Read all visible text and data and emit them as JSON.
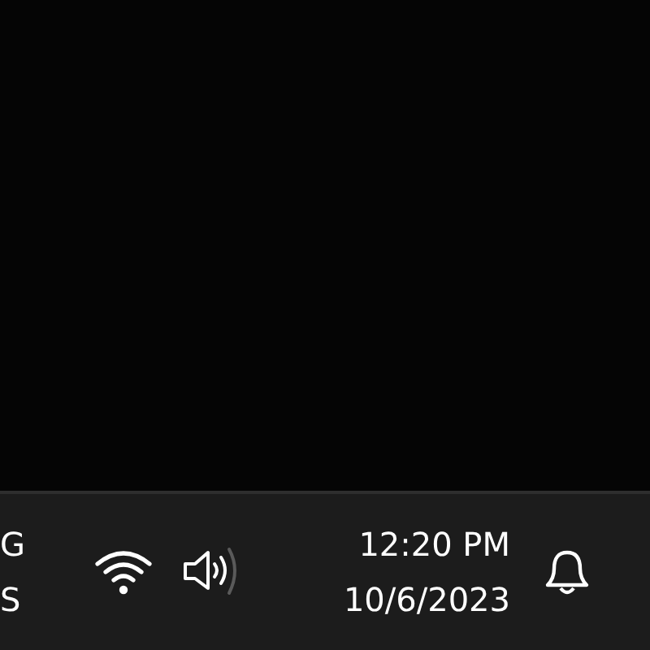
{
  "taskbar": {
    "language": {
      "line_1": "G",
      "line_2": "S"
    },
    "clock": {
      "time": "12:20 PM",
      "date": "10/6/2023"
    }
  }
}
